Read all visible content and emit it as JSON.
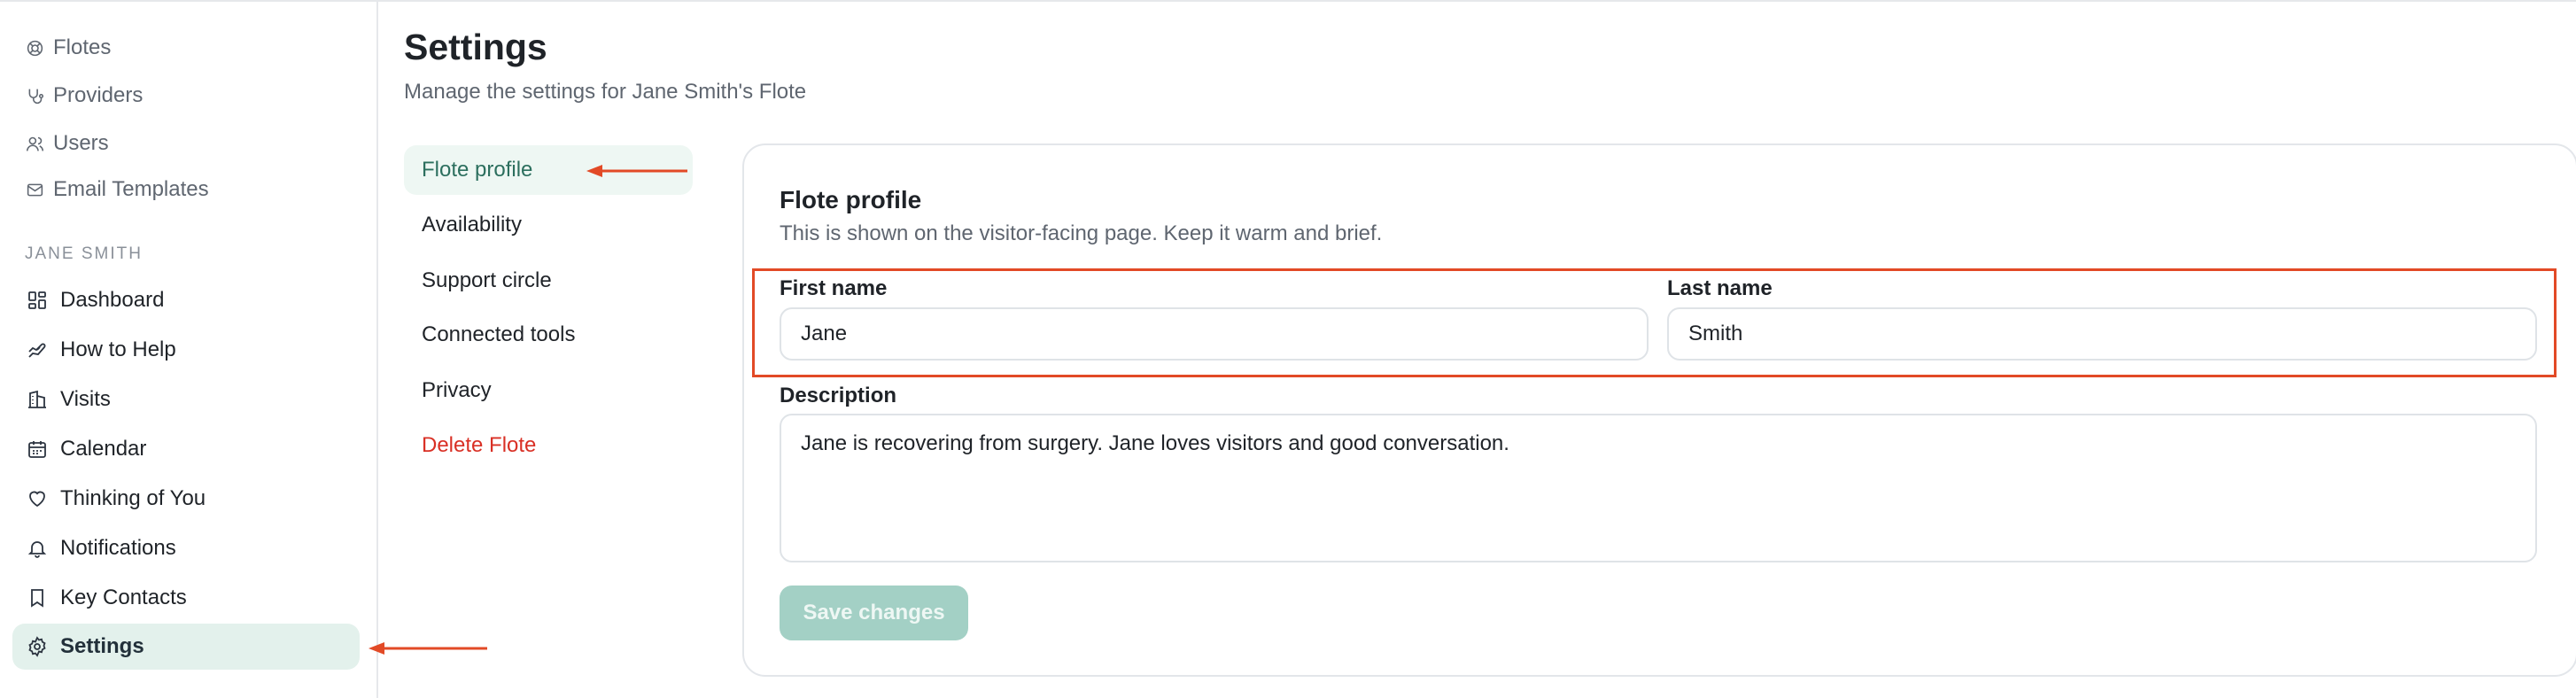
{
  "sidebar": {
    "top_items": [
      {
        "label": "Flotes",
        "icon": "lifebuoy-icon"
      },
      {
        "label": "Providers",
        "icon": "stethoscope-icon"
      },
      {
        "label": "Users",
        "icon": "users-icon"
      },
      {
        "label": "Email Templates",
        "icon": "mail-icon"
      }
    ],
    "section_label": "JANE SMITH",
    "items": [
      {
        "label": "Dashboard",
        "icon": "dashboard-icon"
      },
      {
        "label": "How to Help",
        "icon": "helping-hand-icon"
      },
      {
        "label": "Visits",
        "icon": "building-icon"
      },
      {
        "label": "Calendar",
        "icon": "calendar-icon"
      },
      {
        "label": "Thinking of You",
        "icon": "heart-icon"
      },
      {
        "label": "Notifications",
        "icon": "bell-icon"
      },
      {
        "label": "Key Contacts",
        "icon": "bookmark-icon"
      },
      {
        "label": "Settings",
        "icon": "gear-icon",
        "active": true
      }
    ]
  },
  "header": {
    "title": "Settings",
    "subtitle": "Manage the settings for Jane Smith's Flote"
  },
  "subnav": {
    "items": [
      {
        "label": "Flote profile",
        "active": true
      },
      {
        "label": "Availability"
      },
      {
        "label": "Support circle"
      },
      {
        "label": "Connected tools"
      },
      {
        "label": "Privacy"
      },
      {
        "label": "Delete Flote",
        "danger": true
      }
    ]
  },
  "profile_card": {
    "title": "Flote profile",
    "description": "This is shown on the visitor-facing page. Keep it warm and brief.",
    "first_name_label": "First name",
    "first_name_value": "Jane",
    "last_name_label": "Last name",
    "last_name_value": "Smith",
    "description_label": "Description",
    "description_value": "Jane is recovering from surgery. Jane loves visitors and good conversation.",
    "save_label": "Save changes"
  },
  "colors": {
    "accent": "#2c6f5e",
    "active_bg": "#e3f1ec",
    "danger": "#d93025",
    "annotation": "#e24a26",
    "button_disabled": "#a3d0c5"
  }
}
